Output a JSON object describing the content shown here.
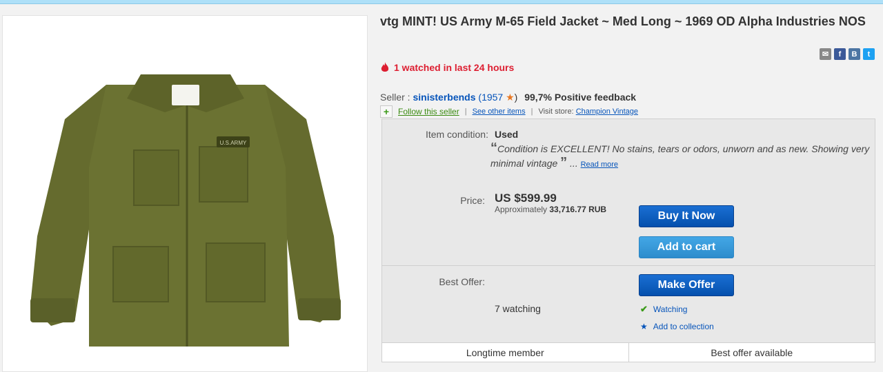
{
  "listing": {
    "title": "vtg MINT! US Army M-65 Field Jacket ~ Med Long ~ 1969 OD Alpha Industries NOS",
    "watched_notice": "1 watched in last 24 hours",
    "image_patch_text": "U.S.ARMY"
  },
  "share": {
    "email_icon": "envelope-icon",
    "facebook": "f",
    "vk": "B",
    "twitter": "t"
  },
  "seller": {
    "label": "Seller :",
    "name": "sinisterbends",
    "score": "1957",
    "feedback": "99,7% Positive feedback",
    "follow": "Follow this seller",
    "see_other": "See other items",
    "visit_store_label": "Visit store:",
    "store_name": "Champion Vintage"
  },
  "item": {
    "condition_label": "Item condition:",
    "condition_value": "Used",
    "condition_quote": "Condition is EXCELLENT! No stains, tears or odors, unworn and as new. Showing very minimal vintage",
    "read_more": "Read more"
  },
  "pricing": {
    "price_label": "Price:",
    "price": "US $599.99",
    "approx_label": "Approximately",
    "approx_value": "33,716.77 RUB",
    "buy_now": "Buy It Now",
    "add_to_cart": "Add to cart",
    "best_offer_label": "Best Offer:",
    "make_offer": "Make Offer",
    "watching_count": "7 watching",
    "watching_link": "Watching",
    "add_collection": "Add to collection"
  },
  "badges": {
    "left": "Longtime member",
    "right": "Best offer available"
  },
  "colors": {
    "brand_blue": "#0654ba",
    "alert_red": "#dd1e31",
    "jacket_olive": "#6b7232"
  }
}
